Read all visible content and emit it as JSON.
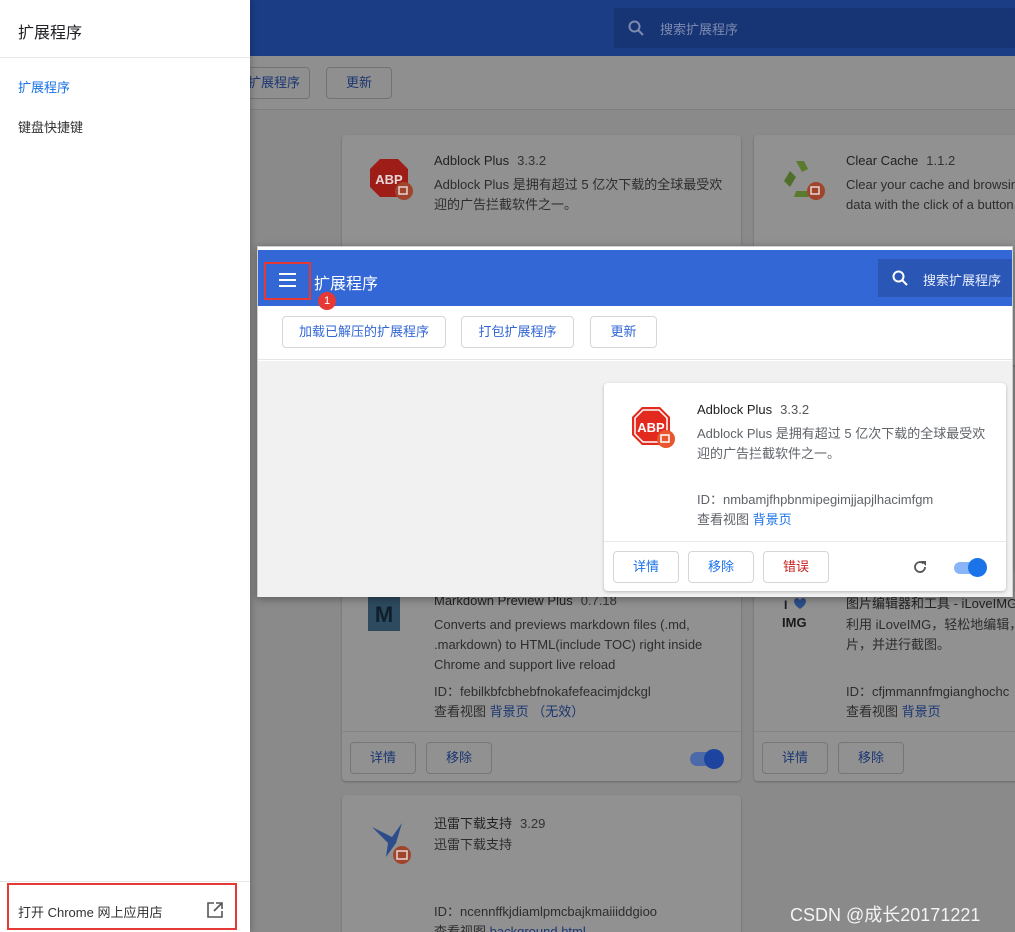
{
  "background": {
    "search_placeholder": "搜索扩展程序",
    "toolbar": {
      "pack_label": "扩展程序",
      "update_label": "更新"
    },
    "cards": [
      {
        "name": "Adblock Plus",
        "version": "3.3.2",
        "desc": "Adblock Plus 是拥有超过 5 亿次下载的全球最受欢迎的广告拦截软件之一。",
        "icon": "abp-icon"
      },
      {
        "name": "Clear Cache",
        "version": "1.1.2",
        "desc": "Clear your cache and browsing data with the click of a button.",
        "icon": "recycle-icon"
      },
      {
        "name": "Markdown Preview Plus",
        "version": "0.7.18",
        "desc": "Converts and previews markdown files (.md, .markdown) to HTML(include TOC) right inside Chrome and support live reload",
        "id": "ID：febilkbfcbhebfnokafefeacimjdckgl",
        "view_label": "查看视图",
        "bg_link": "背景页",
        "invalid": "（无效）",
        "details": "详情",
        "remove": "移除",
        "icon": "markdown-icon"
      },
      {
        "name": "图片编辑器和工具 - iLoveIMG",
        "desc": "利用 iLoveIMG，轻松地编辑，片，并进行截图。",
        "id": "ID：cfjmmannfmgianghochc",
        "view_label": "查看视图",
        "bg_link": "背景页",
        "details": "详情",
        "remove": "移除",
        "icon": "iloveimg-icon"
      },
      {
        "name": "迅雷下载支持",
        "version": "3.29",
        "desc": "迅雷下载支持",
        "id": "ID：ncennffkjdiamlpmcbajkmaiiiddgioo",
        "view_label": "查看视图",
        "bg_link": "background.html",
        "icon": "thunder-icon"
      }
    ]
  },
  "drawer": {
    "title": "扩展程序",
    "items": [
      {
        "label": "扩展程序",
        "active": true
      },
      {
        "label": "键盘快捷键",
        "active": false
      }
    ],
    "webstore_label": "打开 Chrome 网上应用店"
  },
  "popup": {
    "title": "扩展程序",
    "badge": "1",
    "search_placeholder": "搜索扩展程序",
    "toolbar": {
      "load_unpacked": "加载已解压的扩展程序",
      "pack": "打包扩展程序",
      "update": "更新"
    },
    "card": {
      "name": "Adblock Plus",
      "version": "3.3.2",
      "desc": "Adblock Plus 是拥有超过 5 亿次下载的全球最受欢迎的广告拦截软件之一。",
      "id": "ID：nmbamjfhpbnmipegimjjapjlhacimfgm",
      "view_label": "查看视图",
      "bg_link": "背景页",
      "details": "详情",
      "remove": "移除",
      "errors": "错误",
      "enabled": true
    }
  },
  "watermark": "CSDN @成长20171221",
  "colors": {
    "accent": "#3367d6",
    "highlight": "#e53935",
    "link": "#1a73e8"
  }
}
